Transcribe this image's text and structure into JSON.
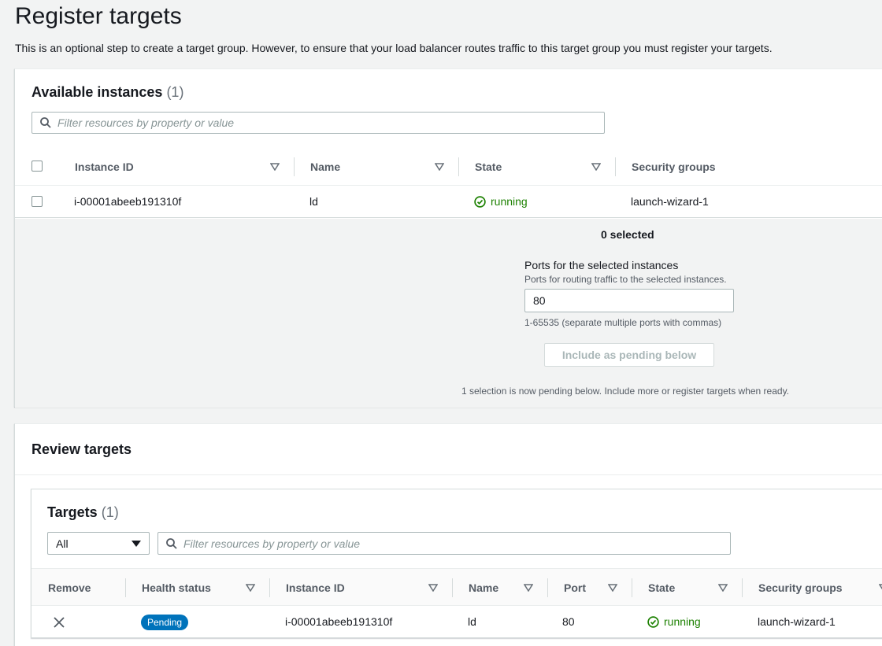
{
  "page": {
    "title": "Register targets",
    "description": "This is an optional step to create a target group. However, to ensure that your load balancer routes traffic to this target group you must register your targets."
  },
  "available": {
    "title": "Available instances",
    "count": "(1)",
    "search_placeholder": "Filter resources by property or value",
    "columns": [
      "Instance ID",
      "Name",
      "State",
      "Security groups"
    ],
    "rows": [
      {
        "instance_id": "i-00001abeeb191310f",
        "name": "ld",
        "state": "running",
        "security_groups": "launch-wizard-1"
      }
    ],
    "selected_text": "0 selected",
    "ports_label": "Ports for the selected instances",
    "ports_desc": "Ports for routing traffic to the selected instances.",
    "ports_value": "80",
    "ports_hint": "1-65535 (separate multiple ports with commas)",
    "include_button": "Include as pending below",
    "pending_note": "1 selection is now pending below. Include more or register targets when ready."
  },
  "review": {
    "title": "Review targets",
    "targets_title": "Targets",
    "targets_count": "(1)",
    "filter_select": "All",
    "search_placeholder": "Filter resources by property or value",
    "columns": [
      "Remove",
      "Health status",
      "Instance ID",
      "Name",
      "Port",
      "State",
      "Security groups"
    ],
    "rows": [
      {
        "health": "Pending",
        "instance_id": "i-00001abeeb191310f",
        "name": "ld",
        "port": "80",
        "state": "running",
        "security_groups": "launch-wizard-1"
      }
    ]
  },
  "colors": {
    "success": "#1d8102",
    "primary": "#0073bb"
  }
}
